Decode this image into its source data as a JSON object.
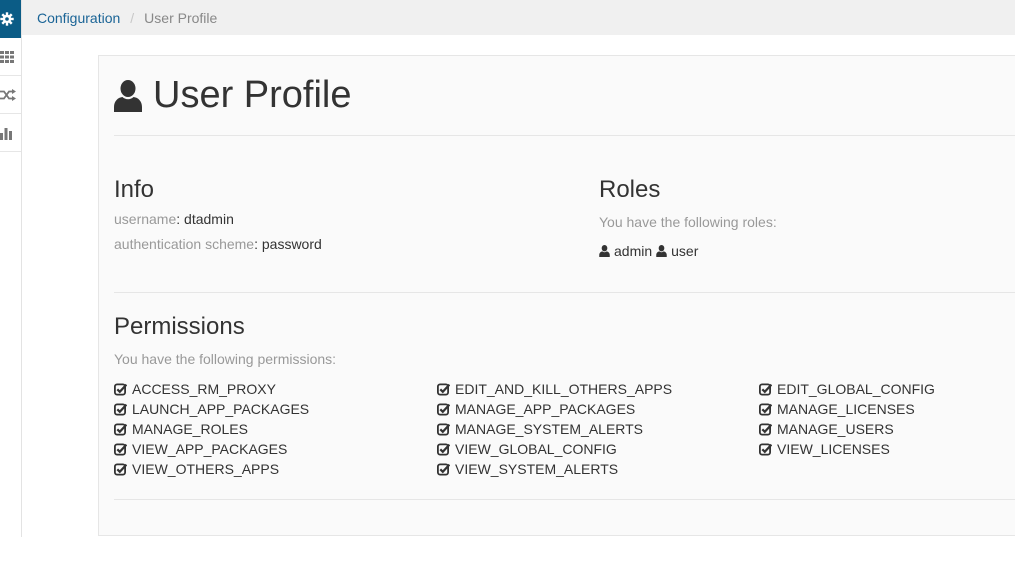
{
  "sidebar": {
    "items": [
      {
        "icon": "gear-icon",
        "active": true
      },
      {
        "icon": "grid-icon",
        "active": false
      },
      {
        "icon": "shuffle-icon",
        "active": false
      },
      {
        "icon": "bar-chart-icon",
        "active": false
      }
    ]
  },
  "breadcrumb": {
    "parent": "Configuration",
    "separator": "/",
    "current": "User Profile"
  },
  "page": {
    "title": "User Profile",
    "title_icon": "user-icon"
  },
  "info": {
    "heading": "Info",
    "username_label": "username",
    "username_value": "dtadmin",
    "auth_label": "authentication scheme",
    "auth_value": "password"
  },
  "roles": {
    "heading": "Roles",
    "subtitle": "You have the following roles:",
    "items": [
      "admin",
      "user"
    ]
  },
  "permissions": {
    "heading": "Permissions",
    "subtitle": "You have the following permissions:",
    "col1": [
      "ACCESS_RM_PROXY",
      "LAUNCH_APP_PACKAGES",
      "MANAGE_ROLES",
      "VIEW_APP_PACKAGES",
      "VIEW_OTHERS_APPS"
    ],
    "col2": [
      "EDIT_AND_KILL_OTHERS_APPS",
      "MANAGE_APP_PACKAGES",
      "MANAGE_SYSTEM_ALERTS",
      "VIEW_GLOBAL_CONFIG",
      "VIEW_SYSTEM_ALERTS"
    ],
    "col3": [
      "EDIT_GLOBAL_CONFIG",
      "MANAGE_LICENSES",
      "MANAGE_USERS",
      "VIEW_LICENSES"
    ]
  },
  "colors": {
    "sidebar_active": "#0b5c86",
    "link": "#1a6496",
    "muted": "#999999"
  }
}
